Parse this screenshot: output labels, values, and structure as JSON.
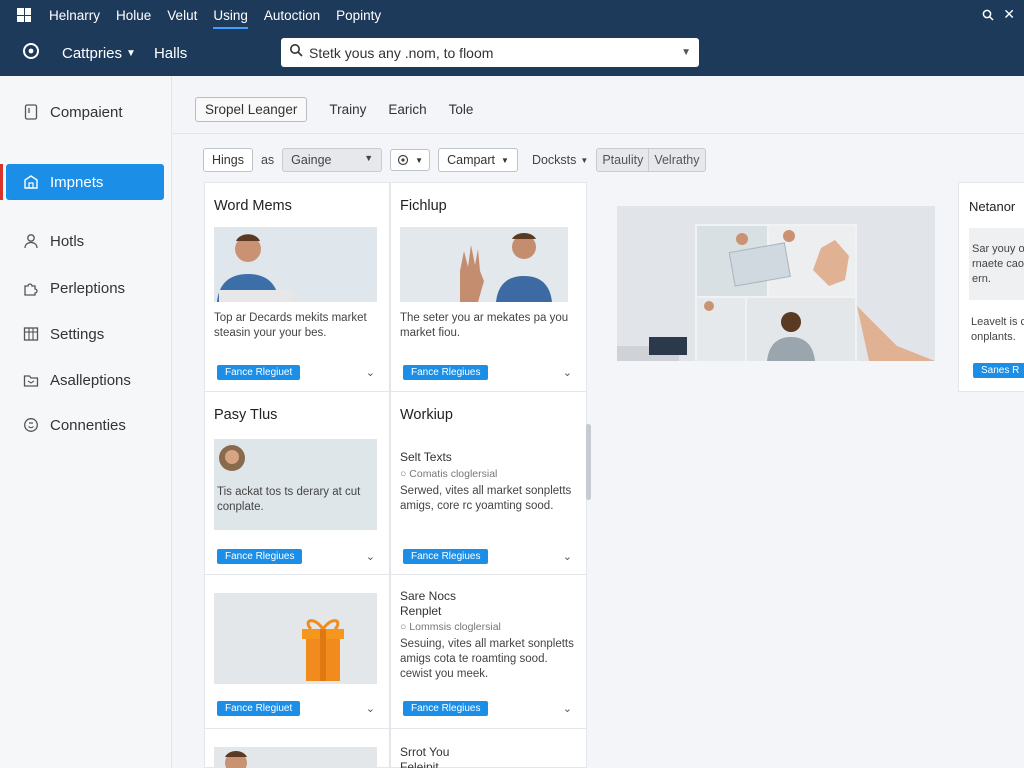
{
  "menubar": {
    "items": [
      {
        "label": "Helnarry",
        "active": false
      },
      {
        "label": "Holue",
        "active": false
      },
      {
        "label": "Velut",
        "active": false
      },
      {
        "label": "Using",
        "active": true
      },
      {
        "label": "Autoction",
        "active": false
      },
      {
        "label": "Popinty",
        "active": false
      }
    ],
    "icons": [
      "app-grid-icon",
      "search-icon",
      "close-icon"
    ]
  },
  "toolbar": {
    "categories_label": "Cattpries",
    "halls_label": "Halls",
    "search_value": "Stetk yous any .nom, to floom",
    "icons": [
      "home-icon",
      "chevron-down-icon"
    ]
  },
  "sidebar": {
    "items": [
      {
        "label": "Compaient",
        "icon": "document-icon",
        "active": false
      },
      {
        "label": "Impnets",
        "icon": "building-icon",
        "active": true
      },
      {
        "label": "Hotls",
        "icon": "user-icon",
        "active": false
      },
      {
        "label": "Perleptions",
        "icon": "puzzle-icon",
        "active": false
      },
      {
        "label": "Settings",
        "icon": "grid-icon",
        "active": false
      },
      {
        "label": "Asalleptions",
        "icon": "folder-icon",
        "active": false
      },
      {
        "label": "Connenties",
        "icon": "circle-icon",
        "active": false
      }
    ]
  },
  "tabs": [
    {
      "label": "Sropel Leanger",
      "selected": true
    },
    {
      "label": "Trainy",
      "selected": false
    },
    {
      "label": "Earich",
      "selected": false
    },
    {
      "label": "Tole",
      "selected": false
    }
  ],
  "filters": {
    "hings": "Hings",
    "as": "as",
    "gainge": "Gainge",
    "campart": "Campart",
    "docksts": "Docksts",
    "seg": [
      "Ptaulity",
      "Velrathy"
    ]
  },
  "cards": [
    {
      "title": "Word Mems",
      "desc": "Top ar Decards mekits market steasin your your bes.",
      "badge": "Fance Rlegiuet"
    },
    {
      "title": "Fichlup",
      "desc": "The seter you ar mekates pa you market fiou.",
      "badge": "Fance Rlegiues"
    },
    {
      "title": "Pasy Tlus",
      "desc": "Tis ackat tos ts derary at cut conplate.",
      "badge": "Fance Rlegiues"
    },
    {
      "title": "Workiup",
      "subtitle": "Selt Texts",
      "meta": "Comatis cloglersial",
      "desc": "Serwed, vites all market sonpletts amigs, core rc yoamting sood.",
      "badge": "Fance Rlegiues"
    },
    {
      "subtitle": "Sare Nocs",
      "subtitle2": "Renplet",
      "meta": "Lommsis cloglersial",
      "desc": "Sesuing, vites all market sonpletts amigs cota te roamting sood. cewist you meek.",
      "badge": "Fance Rlegiuet",
      "badge2": "Fance Rlegiues"
    },
    {
      "subtitle": "Srrot You",
      "subtitle2": "Feleipit"
    }
  ],
  "side_card": {
    "title": "Netanor",
    "desc": "Sar youy ornaete caoern.",
    "desc2": "Leavelt is conplants.",
    "badge": "Sanes R"
  }
}
